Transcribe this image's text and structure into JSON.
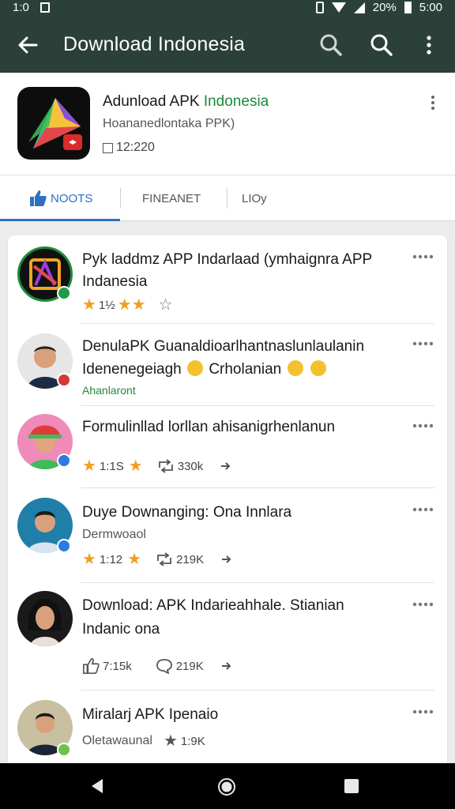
{
  "status_bar": {
    "time_left": "1:0",
    "battery_pct": "20%",
    "time_right": "5:00"
  },
  "app_bar": {
    "title": "Download Indonesia",
    "back_icon": "arrow-left-icon",
    "search_icon": "search-icon",
    "more_icon": "more-vertical-icon"
  },
  "app": {
    "name_main": "Adunload APK ",
    "name_accent": "Indonesia",
    "subtitle": "Hoananedlontaka PPK)",
    "meta": "12:220"
  },
  "tabs": [
    {
      "label": "NOOTS",
      "icon": "thumbs-up-icon",
      "active": true
    },
    {
      "label": "FINEANET",
      "active": false
    },
    {
      "label": "LIOy",
      "active": false
    }
  ],
  "posts": [
    {
      "title": "Pyk laddmz APP Indarlaad (ymhaignra APP",
      "title2": "Indanesia",
      "rating": "1½",
      "avatar_colors": [
        "#e06a2a",
        "#7c3aed"
      ]
    },
    {
      "title": "DenulaPK Guanaldioarlhantnaslunlaulanin",
      "title2": "Idenenegeiagh",
      "title2_extra": "Crholanian",
      "sub": "Ahanlaront",
      "badge_color": "#d23a3a"
    },
    {
      "title": "Formulinllad lorllan ahisanigrhenlanun",
      "rating": "1:1S",
      "shares": "330k",
      "badge_color": "#2d7be0"
    },
    {
      "title": "Duye Downanging: Ona Innlara",
      "sub": "Dermwoaol",
      "rating": "1:12",
      "shares": "219K",
      "badge_color": "#2d7be0"
    },
    {
      "title": "Download: APK Indarieahhale. Stianian",
      "title2": "Indanic ona",
      "likes": "7:15k",
      "comments": "219K"
    },
    {
      "title": "Miralarj APK Ipenaio",
      "sub": "Oletawaunal",
      "shares": "1:9K",
      "badge_color": "#6cc24a"
    }
  ],
  "colors": {
    "app_bar": "#2b4038",
    "accent_blue": "#2d6fc4",
    "accent_green": "#1e8a3a",
    "star": "#f0a020"
  },
  "nav": {
    "back_icon": "nav-back-icon",
    "home_icon": "nav-home-icon",
    "recents_icon": "nav-recents-icon"
  }
}
